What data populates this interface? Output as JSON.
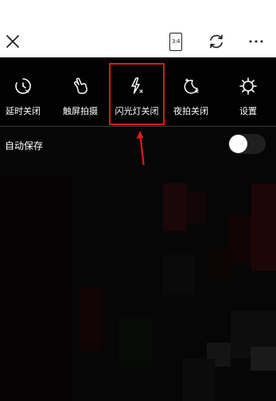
{
  "top_bar": {
    "close_icon": "close-icon",
    "ratio_text": "3:4",
    "switch_icon": "camera-switch-icon",
    "more_icon": "more-icon"
  },
  "settings": {
    "items": [
      {
        "label": "延时关闭",
        "icon": "timer-icon"
      },
      {
        "label": "触屏拍摄",
        "icon": "touch-icon"
      },
      {
        "label": "闪光灯关闭",
        "icon": "flash-off-icon"
      },
      {
        "label": "夜拍关闭",
        "icon": "night-mode-icon"
      },
      {
        "label": "设置",
        "icon": "gear-icon"
      }
    ],
    "highlighted_index": 2,
    "highlight_color": "#e21818"
  },
  "auto_save": {
    "label": "自动保存",
    "enabled": false
  },
  "annotation": {
    "arrow_color": "#e21818"
  }
}
